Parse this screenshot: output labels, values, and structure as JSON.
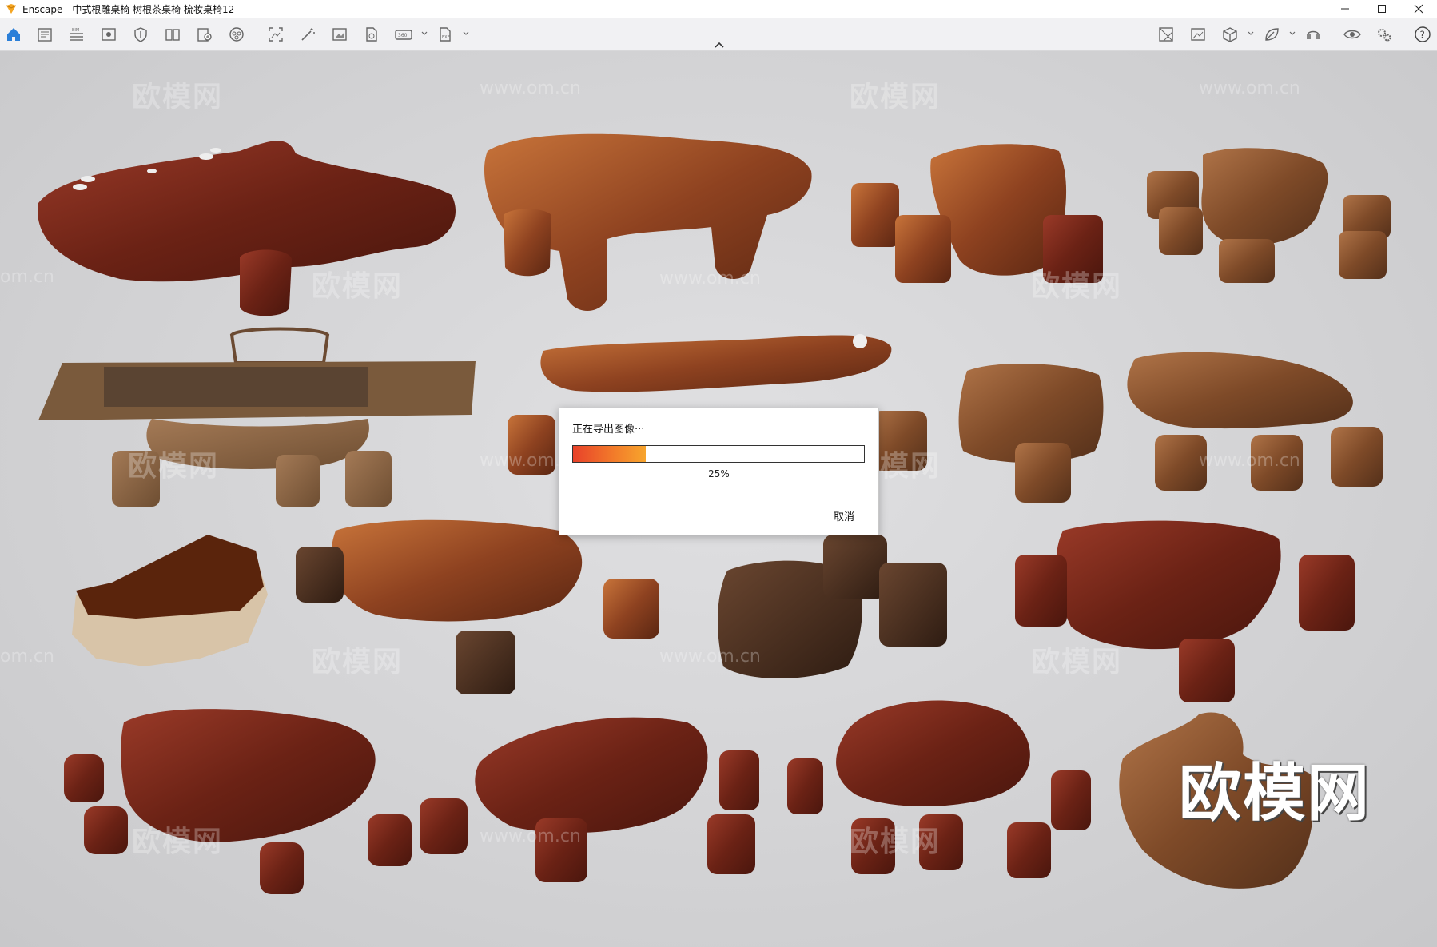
{
  "window": {
    "app_name": "Enscape",
    "title": "Enscape - 中式根雕桌椅 树根茶桌椅 梳妆桌椅12"
  },
  "toolbar": {
    "left_tools": [
      "home-icon",
      "document-icon",
      "bim-list-icon",
      "view-icon",
      "shield-icon",
      "book-icon",
      "export-icon",
      "vr-icon",
      "screenshot-icon",
      "magic-wand-icon",
      "image-icon",
      "render-file-icon",
      "panorama-360-icon",
      "export-exe-icon"
    ],
    "right_tools": [
      "map-icon",
      "image-settings-icon",
      "cube-icon",
      "leaf-icon",
      "headset-icon",
      "eye-icon",
      "gears-icon",
      "help-icon"
    ]
  },
  "viewport": {
    "watermarks": {
      "brand": "欧模网",
      "url": "www.om.cn",
      "url_partial": "om.cn"
    }
  },
  "dialog": {
    "title": "正在导出图像···",
    "progress_value": 25,
    "progress_text": "25%",
    "cancel_label": "取消"
  },
  "colors": {
    "accent": "#2b7fd8",
    "progress_start": "#e8422a",
    "progress_end": "#f7a52d",
    "wood_red": "#7a2a1c",
    "wood_brown": "#8a5230"
  }
}
